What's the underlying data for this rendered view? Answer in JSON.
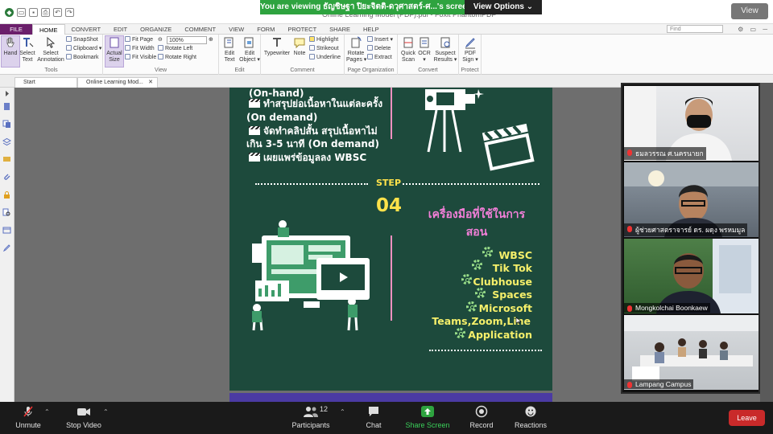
{
  "window": {
    "title": "Online Learning Model (PDF).pdf - Foxit PhantomPDF"
  },
  "share_banner": {
    "message": "You are viewing ธัญชิษฐา ปิยะจิตติ-ดวุศาสตร์-ศ...'s screen",
    "options_label": "View Options ⌄"
  },
  "view_button": "View",
  "menu": {
    "tabs": [
      "FILE",
      "HOME",
      "CONVERT",
      "EDIT",
      "ORGANIZE",
      "COMMENT",
      "VIEW",
      "FORM",
      "PROTECT",
      "SHARE",
      "HELP"
    ],
    "active": "HOME",
    "find_placeholder": "Find"
  },
  "ribbon": {
    "tools": {
      "label": "Tools",
      "hand": "Hand",
      "select_text": "Select\nText",
      "select_annotation": "Select\nAnnotation",
      "snapshot": "SnapShot",
      "clipboard": "Clipboard ▾",
      "bookmark": "Bookmark"
    },
    "view": {
      "label": "View",
      "actual_size": "Actual\nSize",
      "fit_page": "Fit Page",
      "fit_width": "Fit Width",
      "fit_visible": "Fit Visible",
      "zoom": "100%",
      "rotate_left": "Rotate Left",
      "rotate_right": "Rotate Right"
    },
    "edit": {
      "label": "Edit",
      "edit_text": "Edit\nText",
      "edit_object": "Edit\nObject ▾"
    },
    "comment": {
      "label": "Comment",
      "typewriter": "Typewriter",
      "note": "Note",
      "highlight": "Highlight",
      "strikeout": "Strikeout",
      "underline": "Underline"
    },
    "page_org": {
      "label": "Page Organization",
      "rotate_pages": "Rotate\nPages ▾",
      "insert": "Insert ▾",
      "delete": "Delete",
      "extract": "Extract"
    },
    "convert": {
      "label": "Convert",
      "quick_scan": "Quick\nScan",
      "ocr": "OCR\n▾",
      "suspect_results": "Suspect\nResults ▾"
    },
    "protect": {
      "label": "Protect",
      "pdf_sign": "PDF\nSign ▾"
    }
  },
  "doc_tabs": [
    {
      "label": "Start"
    },
    {
      "label": "Online Learning Mod...",
      "close": "✕"
    }
  ],
  "pdf": {
    "left_lines": [
      "(On-hand)",
      "ทำสรุปย่อเนื้อหาในแต่ละครั้ง",
      "(On demand)",
      "จัดทำคลิปสั้น สรุปเนื้อหาไม่",
      "เกิน 3-5 นาที (On demand)",
      "เผยแพร่ข้อมูลลง WBSC"
    ],
    "step_label": "STEP",
    "step_number": "04",
    "tools_heading_1": "เครื่องมือที่ใช้ในการ",
    "tools_heading_2": "สอน",
    "tools": [
      "WBSC",
      "Tik Tok",
      "Clubhouse",
      "Spaces",
      "Microsoft",
      "Teams,Zoom,Line",
      "Application"
    ]
  },
  "participants": [
    {
      "name": "ธมลวรรณ  ศ.นครนายก"
    },
    {
      "name": "ผู้ช่วยศาสตราจารย์ ดร. ผดุง  พรหมมูล"
    },
    {
      "name": "Mongkolchai Boonkaew"
    },
    {
      "name": "Lampang Campus"
    }
  ],
  "zoom_bar": {
    "unmute": "Unmute",
    "stop_video": "Stop Video",
    "participants": "Participants",
    "participant_count": "12",
    "chat": "Chat",
    "share_screen": "Share Screen",
    "record": "Record",
    "reactions": "Reactions",
    "leave": "Leave"
  },
  "colors": {
    "page_bg": "#1d4a3c",
    "step_yellow": "#ffe24a",
    "tool_yellow": "#f5ef6a",
    "tool_pink": "#f27fd8",
    "share_green": "#2ea33f",
    "leave_red": "#c92a2a",
    "file_tab": "#6b1f6b"
  }
}
